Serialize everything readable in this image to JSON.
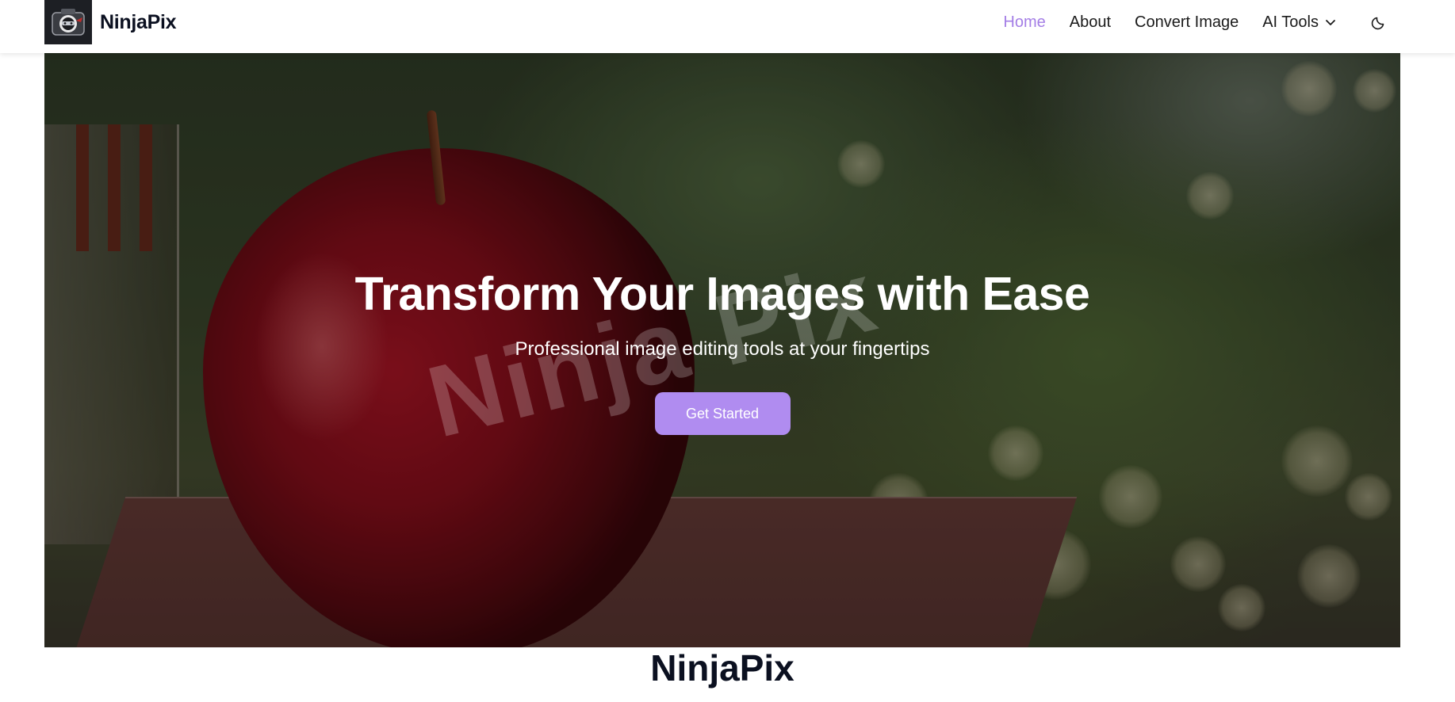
{
  "nav": {
    "brand": "NinjaPix",
    "links": [
      {
        "label": "Home",
        "active": true
      },
      {
        "label": "About"
      },
      {
        "label": "Convert Image"
      },
      {
        "label": "AI Tools",
        "has_dropdown": true
      }
    ],
    "theme_icon": "moon-icon",
    "active_color": "#a47ee6"
  },
  "hero": {
    "title": "Transform Your Images with Ease",
    "subtitle": "Professional image editing tools at your fingertips",
    "cta_label": "Get Started",
    "watermark": "Ninja Pix",
    "cta_color": "#b08cf0"
  },
  "section": {
    "title": "NinjaPix"
  }
}
